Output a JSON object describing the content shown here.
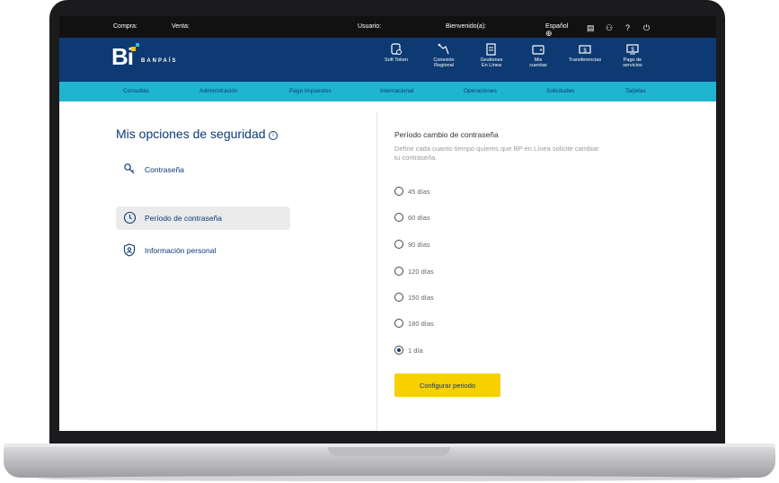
{
  "topbar": {
    "compra": "Compra:",
    "venta": "Venta:",
    "usuario": "Usuario:",
    "bienvenido": "Bienvenido(a):",
    "idioma": "Español"
  },
  "logo": {
    "mark": "Bi",
    "text": "BANPAÍS"
  },
  "mainnav": [
    {
      "line1": "Soft Token",
      "line2": "",
      "icon": "soft-token-icon"
    },
    {
      "line1": "Conexión",
      "line2": "Regional",
      "icon": "regional-connection-icon"
    },
    {
      "line1": "Gestiones",
      "line2": "En Línea",
      "icon": "online-procedures-icon"
    },
    {
      "line1": "Mis",
      "line2": "cuentas",
      "icon": "accounts-icon"
    },
    {
      "line1": "Transferencias",
      "line2": "",
      "icon": "transfers-icon"
    },
    {
      "line1": "Pago de",
      "line2": "servicios",
      "icon": "service-payment-icon"
    }
  ],
  "subnav": [
    "Consultas",
    "Administración",
    "Pago impuestos",
    "Internacional",
    "Operaciones",
    "Solicitudes",
    "Tarjetas"
  ],
  "page": {
    "title": "Mis opciones de seguridad",
    "menu": [
      {
        "label": "Contraseña",
        "icon": "key-icon",
        "active": false
      },
      {
        "label": "Período de contraseña",
        "icon": "clock-icon",
        "active": true
      },
      {
        "label": "Información personal",
        "icon": "shield-user-icon",
        "active": false
      }
    ]
  },
  "period": {
    "title": "Período cambio de contraseña",
    "description": "Define cada cuanto tiempo quieres que BP en Línea solicite cambiar tu contraseña.",
    "options": [
      {
        "label": "45 días",
        "checked": false
      },
      {
        "label": "60 días",
        "checked": false
      },
      {
        "label": "90 días",
        "checked": false
      },
      {
        "label": "120 días",
        "checked": false
      },
      {
        "label": "150 días",
        "checked": false
      },
      {
        "label": "180 días",
        "checked": false
      },
      {
        "label": "1 día",
        "checked": true
      }
    ],
    "button": "Configurar periodo"
  },
  "colors": {
    "brand": "#0d3a73",
    "accent": "#1fb4cf",
    "button": "#f7d000"
  }
}
